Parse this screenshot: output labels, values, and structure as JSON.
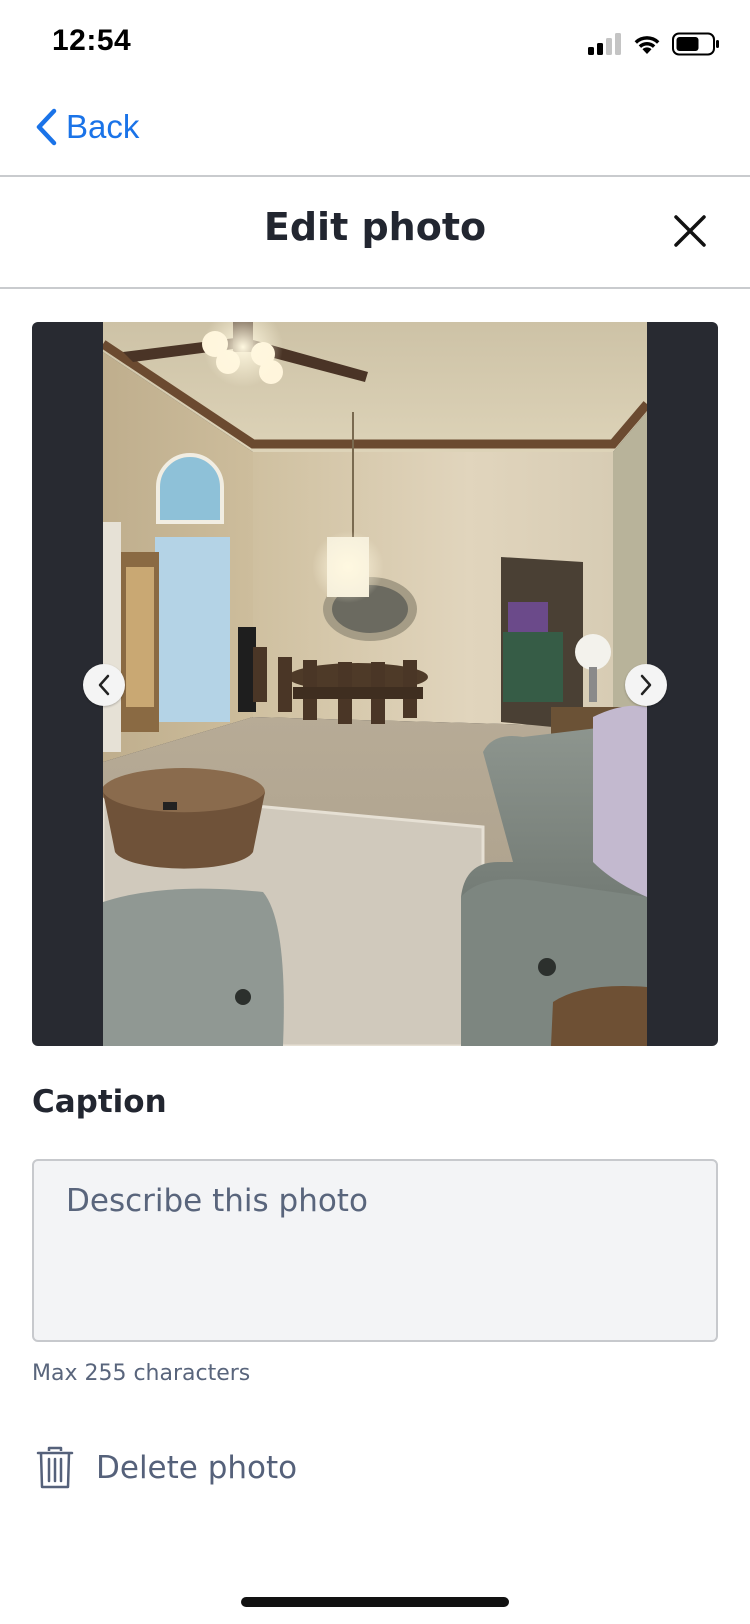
{
  "status_bar": {
    "time": "12:54",
    "icons": [
      "cellular-signal-icon",
      "wifi-icon",
      "battery-icon"
    ]
  },
  "nav": {
    "back_label": "Back",
    "back_icon": "chevron-left-icon",
    "accent_color": "#1a73e8"
  },
  "header": {
    "title": "Edit photo",
    "close_icon": "close-icon"
  },
  "photo_viewer": {
    "photo_alt": "",
    "prev_icon": "chevron-left-icon",
    "next_icon": "chevron-right-icon"
  },
  "caption": {
    "label": "Caption",
    "placeholder": "Describe this photo",
    "value": "",
    "hint": "Max 255 characters"
  },
  "delete": {
    "label": "Delete photo",
    "icon": "trash-icon"
  }
}
